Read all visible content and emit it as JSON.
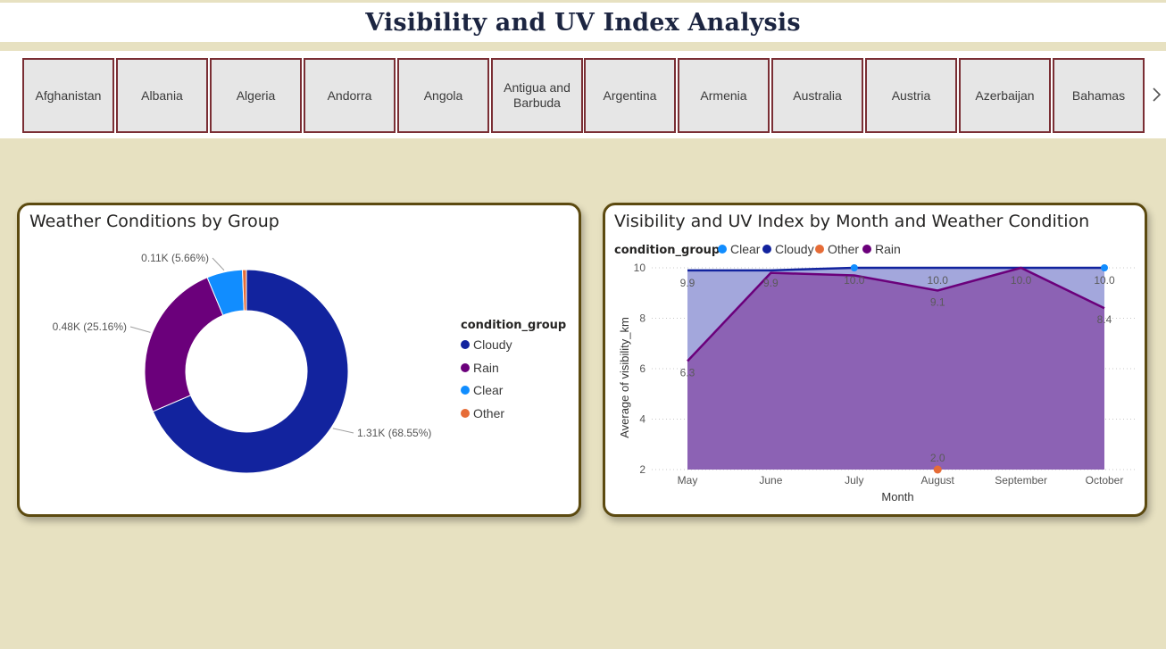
{
  "header": {
    "title": "Visibility and UV Index Analysis"
  },
  "slicer": {
    "countries": [
      "Afghanistan",
      "Albania",
      "Algeria",
      "Andorra",
      "Angola",
      "Antigua and Barbuda",
      "Argentina",
      "Armenia",
      "Australia",
      "Austria",
      "Azerbaijan",
      "Bahamas"
    ],
    "next_icon": "chevron-right-icon"
  },
  "donut": {
    "title": "Weather Conditions by Group",
    "legend_title": "condition_group",
    "legend": [
      {
        "label": "Cloudy",
        "color": "#12239e"
      },
      {
        "label": "Rain",
        "color": "#6b007b"
      },
      {
        "label": "Clear",
        "color": "#118dff"
      },
      {
        "label": "Other",
        "color": "#e66c37"
      }
    ],
    "labels": {
      "cloudy": "1.31K (68.55%)",
      "rain": "0.48K (25.16%)",
      "clear": "0.11K (5.66%)"
    }
  },
  "area": {
    "title": "Visibility and UV Index by Month and Weather Condition",
    "legend_title": "condition_group",
    "legend": [
      {
        "label": "Clear",
        "color": "#118dff"
      },
      {
        "label": "Cloudy",
        "color": "#12239e"
      },
      {
        "label": "Other",
        "color": "#e66c37"
      },
      {
        "label": "Rain",
        "color": "#6b007b"
      }
    ],
    "xlabel": "Month",
    "ylabel": "Average of visibility_km"
  },
  "chart_data": [
    {
      "type": "pie",
      "title": "Weather Conditions by Group",
      "legend_title": "condition_group",
      "legend_position": "right",
      "slices": [
        {
          "name": "Cloudy",
          "value": 1310,
          "percent": 68.55,
          "color": "#12239e"
        },
        {
          "name": "Rain",
          "value": 480,
          "percent": 25.16,
          "color": "#6b007b"
        },
        {
          "name": "Clear",
          "value": 110,
          "percent": 5.66,
          "color": "#118dff"
        },
        {
          "name": "Other",
          "value": 12,
          "percent": 0.63,
          "color": "#e66c37"
        }
      ]
    },
    {
      "type": "area",
      "title": "Visibility and UV Index by Month and Weather Condition",
      "xlabel": "Month",
      "ylabel": "Average of visibility_km",
      "legend_title": "condition_group",
      "legend_position": "top-left",
      "categories": [
        "May",
        "June",
        "July",
        "August",
        "September",
        "October"
      ],
      "ylim": [
        2,
        10
      ],
      "yticks": [
        2,
        4,
        6,
        8,
        10
      ],
      "grid": true,
      "series": [
        {
          "name": "Cloudy",
          "color": "#12239e",
          "values": [
            9.9,
            9.9,
            10.0,
            10.0,
            10.0,
            10.0
          ],
          "labels": [
            "9.9",
            "9.9",
            "10.0",
            "10.0",
            "10.0",
            "10.0"
          ]
        },
        {
          "name": "Rain",
          "color": "#6b007b",
          "values": [
            6.3,
            9.8,
            9.7,
            9.1,
            10.0,
            8.4
          ],
          "labels": [
            "6.3",
            "",
            "",
            "9.1",
            "",
            "8.4"
          ]
        },
        {
          "name": "Clear",
          "color": "#118dff",
          "values": [
            null,
            null,
            10.0,
            null,
            null,
            10.0
          ],
          "labels": []
        },
        {
          "name": "Other",
          "color": "#e66c37",
          "values": [
            null,
            null,
            null,
            2.0,
            null,
            null
          ],
          "labels": [
            "",
            "",
            "",
            "2.0",
            "",
            ""
          ]
        }
      ]
    }
  ]
}
